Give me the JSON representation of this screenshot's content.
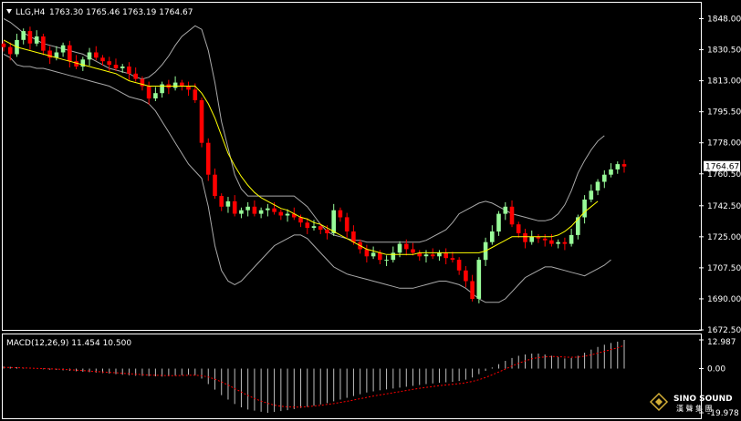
{
  "header": {
    "symbol_tf": "LLG,H4",
    "ohlc": "1763.30 1765.46 1763.19 1764.67"
  },
  "macd_header": {
    "label": "MACD(12,26,9) 11.454 10.500"
  },
  "watermark": {
    "brand": "SINO SOUND",
    "sub": "漢 聲 集 團"
  },
  "colors": {
    "background": "#000000",
    "bull": "#98fb98",
    "bear": "#ff0000",
    "band": "#a9a9a9",
    "ma": "#ffff00",
    "frame": "#ffffff",
    "signal": "#ff0000",
    "hist": "#c0c0c0"
  },
  "chart_data": [
    {
      "type": "candlestick",
      "symbol": "LLG",
      "timeframe": "H4",
      "ylim": [
        1672.5,
        1857
      ],
      "y_ticks": [
        "1848.00",
        "1830.50",
        "1813.00",
        "1795.50",
        "1778.00",
        "1760.50",
        "1742.50",
        "1725.00",
        "1707.50",
        "1690.00",
        "1672.50"
      ],
      "last_price_label": "1764.67",
      "close": [
        1832,
        1828,
        1836,
        1841,
        1834,
        1838,
        1830,
        1826,
        1829,
        1833,
        1824,
        1821,
        1825,
        1829,
        1826,
        1824,
        1822,
        1820,
        1821,
        1817,
        1814,
        1810,
        1803,
        1806,
        1811,
        1809,
        1812,
        1810,
        1808,
        1802,
        1778,
        1760,
        1748,
        1742,
        1745,
        1738,
        1740,
        1742,
        1738,
        1740,
        1741,
        1739,
        1737,
        1738,
        1736,
        1733,
        1730,
        1731,
        1729,
        1727,
        1740,
        1736,
        1728,
        1722,
        1718,
        1714,
        1716,
        1712,
        1712,
        1716,
        1721,
        1718,
        1716,
        1714,
        1715,
        1714,
        1716,
        1713,
        1712,
        1706,
        1700,
        1690,
        1712,
        1722,
        1728,
        1738,
        1742,
        1732,
        1727,
        1722,
        1725,
        1724,
        1723,
        1721,
        1722,
        1721,
        1726,
        1736,
        1746,
        1751,
        1756,
        1760,
        1763,
        1766,
        1764.67
      ],
      "upper_band": [
        1848,
        1846,
        1843,
        1840,
        1838,
        1836,
        1834,
        1833,
        1832,
        1831,
        1830,
        1829,
        1828,
        1826,
        1824,
        1822,
        1820,
        1819,
        1818,
        1817,
        1815,
        1814,
        1815,
        1818,
        1822,
        1827,
        1833,
        1838,
        1841,
        1844,
        1842,
        1830,
        1812,
        1790,
        1775,
        1760,
        1752,
        1748,
        1748,
        1748,
        1748,
        1748,
        1748,
        1748,
        1748,
        1745,
        1742,
        1737,
        1732,
        1728,
        1726,
        1725,
        1724,
        1723,
        1723,
        1722,
        1722,
        1722,
        1722,
        1722,
        1722,
        1722,
        1722,
        1722,
        1723,
        1725,
        1727,
        1729,
        1733,
        1738,
        1740,
        1742,
        1744,
        1745,
        1744,
        1742,
        1740,
        1738,
        1737,
        1736,
        1735,
        1734,
        1734,
        1735,
        1738,
        1743,
        1751,
        1761,
        1768,
        1774,
        1779,
        1782
      ],
      "middle_band": [
        1836,
        1834,
        1832,
        1831,
        1830,
        1829,
        1828,
        1827,
        1826,
        1825,
        1824,
        1823,
        1822,
        1821,
        1820,
        1819,
        1818,
        1817,
        1815,
        1813,
        1812,
        1811,
        1810,
        1810,
        1810,
        1810,
        1810,
        1810,
        1810,
        1810,
        1806,
        1800,
        1792,
        1782,
        1772,
        1765,
        1759,
        1754,
        1750,
        1747,
        1745,
        1743,
        1741,
        1740,
        1738,
        1736,
        1735,
        1733,
        1732,
        1730,
        1728,
        1726,
        1724,
        1722,
        1720,
        1718,
        1717,
        1716,
        1715,
        1715,
        1715,
        1715,
        1715,
        1716,
        1716,
        1716,
        1716,
        1716,
        1716,
        1716,
        1716,
        1716,
        1716,
        1717,
        1719,
        1721,
        1723,
        1725,
        1725,
        1725,
        1725,
        1725,
        1725,
        1725,
        1726,
        1728,
        1731,
        1735,
        1739,
        1742,
        1745
      ],
      "lower_band": [
        1828,
        1826,
        1822,
        1821,
        1821,
        1820,
        1820,
        1819,
        1818,
        1817,
        1816,
        1815,
        1814,
        1813,
        1812,
        1811,
        1810,
        1808,
        1806,
        1804,
        1803,
        1802,
        1800,
        1796,
        1790,
        1784,
        1778,
        1772,
        1766,
        1762,
        1758,
        1742,
        1720,
        1706,
        1700,
        1698,
        1700,
        1704,
        1708,
        1712,
        1716,
        1720,
        1722,
        1724,
        1726,
        1726,
        1724,
        1720,
        1716,
        1712,
        1708,
        1706,
        1704,
        1703,
        1702,
        1701,
        1700,
        1699,
        1698,
        1697,
        1696,
        1696,
        1696,
        1697,
        1698,
        1699,
        1700,
        1700,
        1699,
        1698,
        1696,
        1693,
        1690,
        1688,
        1688,
        1688,
        1690,
        1694,
        1698,
        1702,
        1704,
        1706,
        1708,
        1708,
        1707,
        1706,
        1705,
        1704,
        1703,
        1705,
        1707,
        1709,
        1712
      ]
    },
    {
      "type": "macd",
      "label": "MACD(12,26,9) 11.454 10.500",
      "ylim": [
        -19.978,
        12.987
      ],
      "y_ticks": [
        "12.987",
        "0.00",
        "-19.978"
      ],
      "histogram": [
        1,
        0.8,
        0.6,
        0.4,
        0.2,
        0,
        -0.3,
        -0.5,
        -0.6,
        -0.8,
        -1,
        -1.2,
        -1.4,
        -1.6,
        -1.8,
        -2,
        -2.2,
        -2.5,
        -2.8,
        -3,
        -3.2,
        -3.3,
        -3.4,
        -3.5,
        -3.6,
        -3.4,
        -3.2,
        -3,
        -2.8,
        -3,
        -4.5,
        -7,
        -9.5,
        -12,
        -14,
        -16,
        -17.5,
        -18.5,
        -19,
        -19.5,
        -19.978,
        -19.6,
        -19.2,
        -18.8,
        -18.3,
        -17.8,
        -17.3,
        -16.8,
        -16.2,
        -15.6,
        -14.8,
        -14,
        -13.2,
        -12.4,
        -11.6,
        -10.8,
        -10.3,
        -9.8,
        -9.4,
        -9,
        -8.6,
        -8.2,
        -7.8,
        -7.4,
        -7,
        -6.7,
        -6.4,
        -6.2,
        -6,
        -5.6,
        -5,
        -4,
        -2.5,
        -1,
        0.5,
        2,
        3.5,
        4.8,
        5.8,
        6.4,
        6.8,
        6.8,
        6.4,
        5.8,
        5.2,
        4.6,
        4.8,
        5.8,
        7.2,
        8.6,
        9.8,
        10.8,
        11.6,
        12.2,
        12.987
      ],
      "signal": [
        0.5,
        0.5,
        0.4,
        0.3,
        0.2,
        0.1,
        0,
        -0.1,
        -0.2,
        -0.4,
        -0.5,
        -0.7,
        -0.9,
        -1.1,
        -1.3,
        -1.5,
        -1.7,
        -1.9,
        -2.1,
        -2.3,
        -2.5,
        -2.7,
        -2.9,
        -3,
        -3.1,
        -3.2,
        -3.2,
        -3.1,
        -3,
        -3,
        -3.2,
        -3.8,
        -4.8,
        -6,
        -7.4,
        -9,
        -10.6,
        -12.1,
        -13.5,
        -14.7,
        -15.7,
        -16.5,
        -17,
        -17.3,
        -17.4,
        -17.4,
        -17.2,
        -16.9,
        -16.6,
        -16.2,
        -15.8,
        -15.3,
        -14.8,
        -14.2,
        -13.6,
        -13,
        -12.4,
        -11.9,
        -11.4,
        -10.9,
        -10.4,
        -9.9,
        -9.4,
        -8.9,
        -8.5,
        -8.1,
        -7.7,
        -7.4,
        -7.1,
        -6.8,
        -6.4,
        -5.8,
        -5,
        -4,
        -2.8,
        -1.5,
        -0.2,
        1.2,
        2.4,
        3.5,
        4.4,
        5,
        5.3,
        5.5,
        5.4,
        5.2,
        5.1,
        5.2,
        5.6,
        6.2,
        7,
        7.8,
        8.6,
        9.4,
        10.5
      ]
    }
  ]
}
